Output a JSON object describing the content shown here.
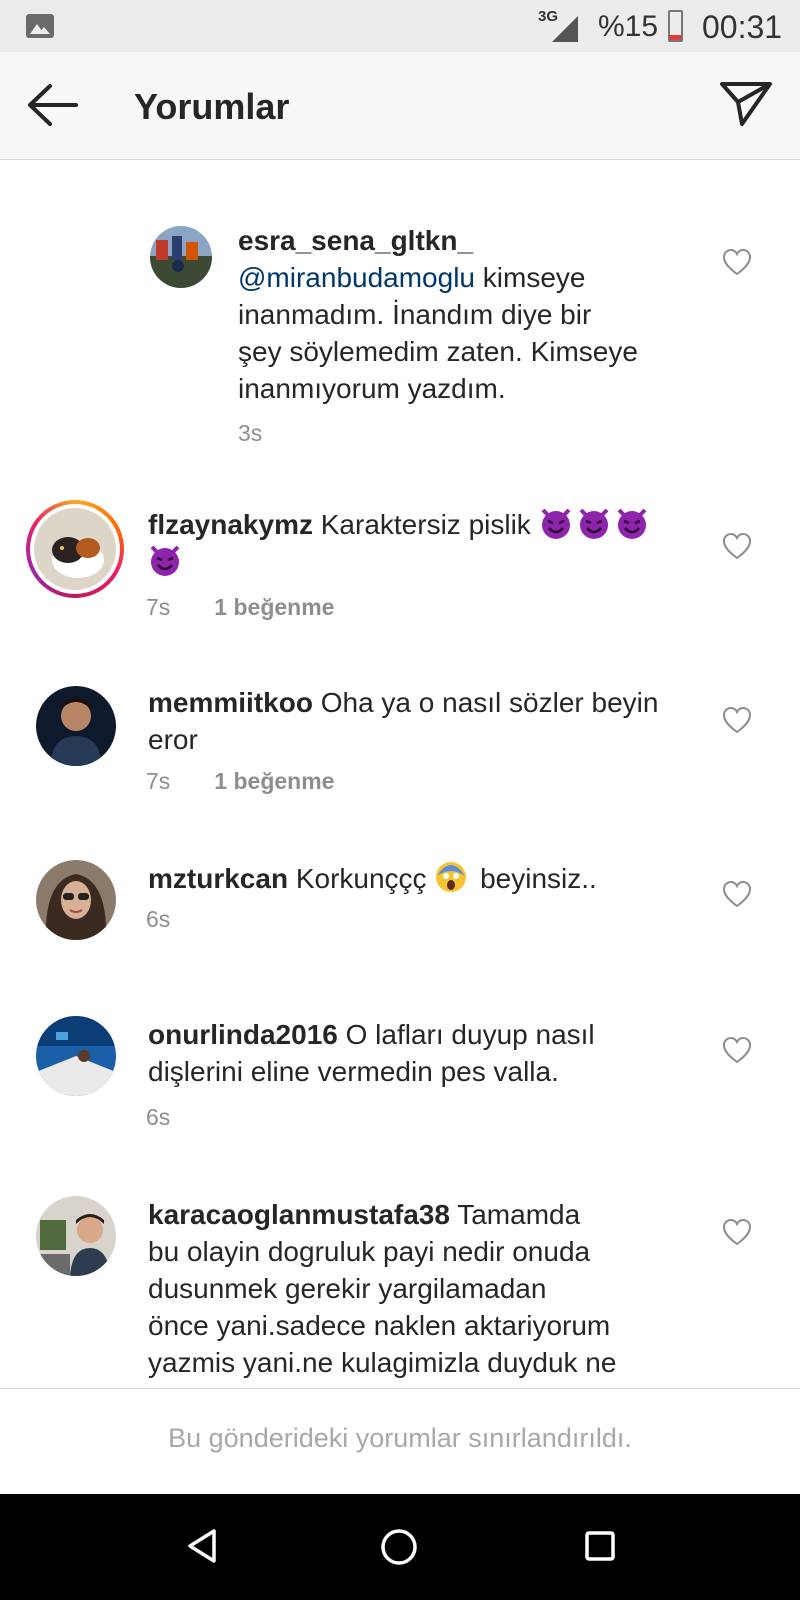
{
  "status_bar": {
    "network": "3G",
    "battery": "%15",
    "time": "00:31"
  },
  "header": {
    "title": "Yorumlar"
  },
  "comments": [
    {
      "username": "esra_sena_gltkn_",
      "mention": "@miranbudamoglu",
      "text_lines": [
        "kimseye",
        "inanmadım. İnandım diye bir",
        "şey söylemedim zaten. Kimseye",
        "inanmıyorum yazdım."
      ],
      "time": "3s",
      "likes": ""
    },
    {
      "username": "flzaynakymz",
      "text": "Karaktersiz pislik",
      "emoji": "smiling-devil",
      "time": "7s",
      "likes": "1 beğenme"
    },
    {
      "username": "memmiitkoo",
      "text_line1": "Oha ya o nasıl sözler beyin",
      "text_line2": "eror",
      "time": "7s",
      "likes": "1 beğenme"
    },
    {
      "username": "mzturkcan",
      "text_before": "Korkunççç",
      "text_after": "beyinsiz..",
      "emoji": "screaming-face",
      "time": "6s",
      "likes": ""
    },
    {
      "username": "onurlinda2016",
      "text_line1": "O lafları duyup nasıl",
      "text_line2": "dişlerini eline vermedin pes valla.",
      "time": "6s",
      "likes": ""
    },
    {
      "username": "karacaoglanmustafa38",
      "text_line1": "Tamamda",
      "text_lines": [
        "bu olayin dogruluk payi nedir onuda",
        "dusunmek gerekir yargilamadan",
        "önce yani.sadece naklen aktariyorum",
        "yazmis yani.ne kulagimizla duyduk ne"
      ],
      "time": "",
      "likes": ""
    }
  ],
  "footer": {
    "restricted_text": "Bu gönderideki yorumlar sınırlandırıldı."
  },
  "colors": {
    "mention": "#00376b",
    "meta": "#8e8e8e",
    "emoji_purple": "#8e24aa"
  }
}
